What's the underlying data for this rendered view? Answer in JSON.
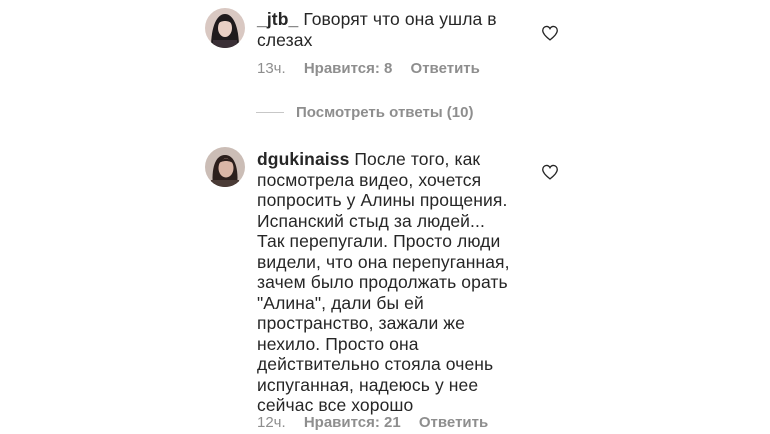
{
  "comments": [
    {
      "username": "_jtb_",
      "text": " Говорят что она ушла в\nслезах",
      "time": "13ч.",
      "likes": "Нравится: 8",
      "reply": "Ответить",
      "view_replies": "Посмотреть ответы (10)"
    },
    {
      "username": "dgukinaiss",
      "text": " После того, как\nпосмотрела видео, хочется\nпопросить у Алины прощения.\nИспанский стыд за людей...\nТак перепугали. Просто люди\nвидели, что она перепуганная,\nзачем было продолжать орать\n\"Алина\", дали бы ей\nпространство, зажали же\nнехило. Просто она\nдействительно стояла очень\nиспуганная, надеюсь у нее\nсейчас все хорошо",
      "time": "12ч.",
      "likes": "Нравится: 21",
      "reply": "Ответить"
    }
  ],
  "icons": {
    "like": "heart-outline-icon"
  },
  "colors": {
    "text": "#262626",
    "meta": "#8e8e8e",
    "divider": "#c7c7c7"
  }
}
